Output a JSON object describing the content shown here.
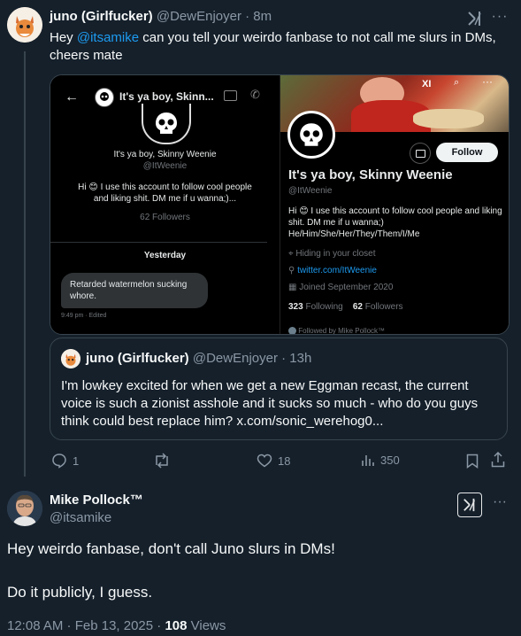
{
  "tweet": {
    "author_name": "juno (Girlfucker)",
    "author_handle": "@DewEnjoyer",
    "time": "· 8m",
    "text_before": "Hey ",
    "mention": "@itsamike",
    "text_after": " can you tell your weirdo fanbase to not call me slurs in DMs, cheers mate",
    "actions": {
      "replies": "1",
      "likes": "18",
      "views": "350"
    }
  },
  "media_left": {
    "header_title": "It's ya boy, Skinn...",
    "profile_name": "It's ya boy, Skinny Weenie",
    "profile_handle": "@ItWeenie",
    "bio": "Hi 😊 I use this account to follow cool people and liking shit. DM me if u wanna;)...",
    "followers": "62 Followers",
    "date_divider": "Yesterday",
    "message": "Retarded watermelon sucking whore.",
    "message_meta": "9:49 pm · Edited"
  },
  "media_right": {
    "follow_label": "Follow",
    "name": "It's ya boy, Skinny Weenie",
    "handle": "@ItWeenie",
    "bio": "Hi 😊 I use this account to follow cool people and liking shit. DM me if u wanna;) He/Him/She/Her/They/Them/I/Me",
    "location": "Hiding in your closet",
    "link": "twitter.com/ItWeenie",
    "joined": "Joined September 2020",
    "following_count": "323",
    "following_label": "Following",
    "followers_count": "62",
    "followers_label": "Followers",
    "followed_by": "Followed by Mike Pollock™"
  },
  "quote": {
    "author_name": "juno (Girlfucker)",
    "author_handle": "@DewEnjoyer",
    "time": "· 13h",
    "text": "I'm lowkey excited for when we get a new Eggman recast, the current voice is such a zionist asshole and it sucks so much - who do you guys think could best replace him? x.com/sonic_werehog0..."
  },
  "reply": {
    "author_name": "Mike Pollock™",
    "author_handle": "@itsamike",
    "line1": "Hey weirdo fanbase, don't call Juno slurs in DMs!",
    "line2": "Do it publicly, I guess.",
    "timestamp": "12:08 AM · Feb 13, 2025 · ",
    "views_count": "108",
    "views_label": " Views"
  },
  "colors": {
    "background": "#15202b",
    "accent": "#1d9bf0",
    "muted": "#8b98a5",
    "border": "#38444d"
  }
}
